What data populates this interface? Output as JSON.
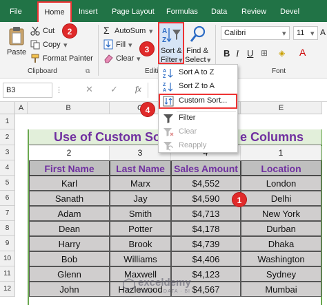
{
  "tabs": [
    {
      "label": "File",
      "active": false
    },
    {
      "label": "Home",
      "active": true
    },
    {
      "label": "Insert",
      "active": false
    },
    {
      "label": "Page Layout",
      "active": false
    },
    {
      "label": "Formulas",
      "active": false
    },
    {
      "label": "Data",
      "active": false
    },
    {
      "label": "Review",
      "active": false
    },
    {
      "label": "Devel",
      "active": false
    }
  ],
  "clipboard": {
    "paste": "Paste",
    "cut": "Cut",
    "copy": "Copy",
    "format_painter": "Format Painter",
    "group_label": "Clipboard"
  },
  "editing": {
    "autosum": "AutoSum",
    "fill": "Fill",
    "clear": "Clear",
    "sort_filter_line1": "Sort &",
    "sort_filter_line2": "Filter",
    "find_select_line1": "Find &",
    "find_select_line2": "Select",
    "group_label": "Editi"
  },
  "font": {
    "family": "Calibri",
    "size": "11",
    "group_label": "Font"
  },
  "formula_bar": {
    "name_box": "B3",
    "fx": "fx"
  },
  "sort_menu": {
    "items": [
      {
        "label": "Sort A to Z",
        "enabled": true,
        "highlighted": false
      },
      {
        "label": "Sort Z to A",
        "enabled": true,
        "highlighted": false
      },
      {
        "label": "Custom Sort...",
        "enabled": true,
        "highlighted": true
      },
      {
        "label": "Filter",
        "enabled": true,
        "highlighted": false
      },
      {
        "label": "Clear",
        "enabled": false,
        "highlighted": false
      },
      {
        "label": "Reapply",
        "enabled": false,
        "highlighted": false
      }
    ]
  },
  "badges": [
    "1",
    "2",
    "3",
    "4"
  ],
  "sheet": {
    "columns": [
      "A",
      "B",
      "C",
      "D",
      "E"
    ],
    "rows": [
      "1",
      "2",
      "3",
      "4",
      "5",
      "6",
      "7",
      "8",
      "9",
      "10",
      "11",
      "12"
    ],
    "title": "Use of Custom So",
    "title_tail": "e Columns",
    "order_row": [
      "2",
      "3",
      "4",
      "1"
    ],
    "headers": [
      "First Name",
      "Last Name",
      "Sales Amount",
      "Location"
    ],
    "data": [
      [
        "Karl",
        "Marx",
        "$4,552",
        "London"
      ],
      [
        "Sanath",
        "Jay",
        "$4,590",
        "Delhi"
      ],
      [
        "Adam",
        "Smith",
        "$4,713",
        "New York"
      ],
      [
        "Dean",
        "Potter",
        "$4,178",
        "Durban"
      ],
      [
        "Harry",
        "Brook",
        "$4,739",
        "Dhaka"
      ],
      [
        "Bob",
        "Williams",
        "$4,406",
        "Washington"
      ],
      [
        "Glenn",
        "Maxwell",
        "$4,123",
        "Sydney"
      ],
      [
        "John",
        "Hazlewood",
        "$4,567",
        "Mumbai"
      ]
    ]
  },
  "watermark": "exceldemy",
  "watermark_sub": "EXCEL · DATA · BI",
  "colors": {
    "excel_green": "#217346",
    "title_purple": "#7030a0",
    "header_fill": "#bfbfbf",
    "data_fill": "#d0cece",
    "badge_red": "#e02a2a"
  }
}
